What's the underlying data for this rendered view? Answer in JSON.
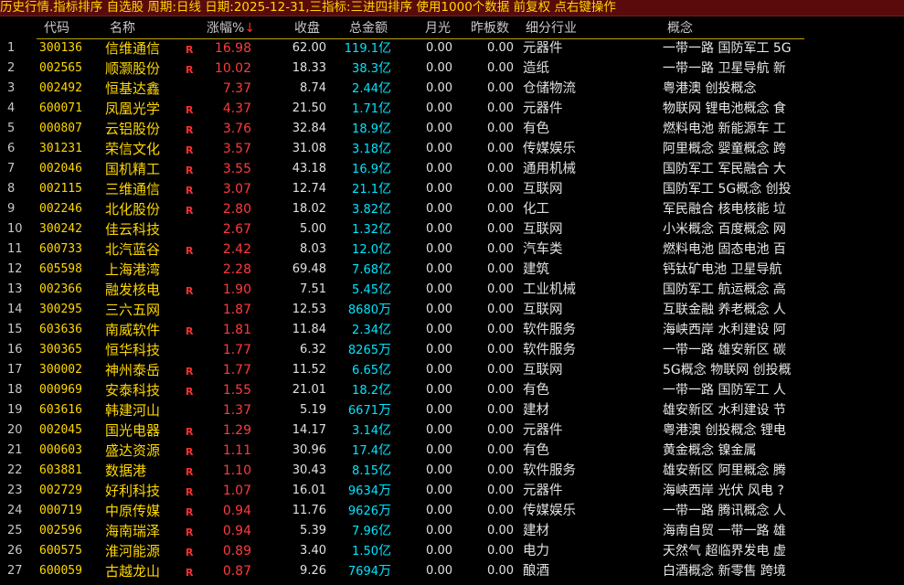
{
  "topbar": {
    "part1": "历史行情.指标排序",
    "part2": "自选股",
    "part3": "周期:",
    "period": "日线",
    "part4": "日期:",
    "date": "2025-12-31,三",
    "part5": "指标:",
    "indicator": "三进四排序",
    "part6": "使用",
    "count": "1000",
    "part7": "个数据 前复权 点右键操作"
  },
  "header": {
    "code": "代码",
    "name": "名称",
    "pct": "涨幅%",
    "sort_arrow": "↓",
    "close": "收盘",
    "amount": "总金额",
    "yueguang": "月光",
    "zhaban": "昨板数",
    "industry": "细分行业",
    "concept": "概念"
  },
  "colors": {
    "topbar_bg": "#5a0a0a",
    "code": "#ffd700",
    "pct": "#ff3b3b",
    "amount": "#00e5ff"
  },
  "rows": [
    {
      "idx": "1",
      "code": "300136",
      "name": "信维通信",
      "r": "R",
      "pct": "16.98",
      "close": "62.00",
      "amt": "119.1",
      "unit": "亿",
      "yg": "0.00",
      "zb": "0.00",
      "ind": "元器件",
      "concept": "一带一路 国防军工 5G"
    },
    {
      "idx": "2",
      "code": "002565",
      "name": "顺灏股份",
      "r": "R",
      "pct": "10.02",
      "close": "18.33",
      "amt": "38.3",
      "unit": "亿",
      "yg": "0.00",
      "zb": "0.00",
      "ind": "造纸",
      "concept": "一带一路 卫星导航 新"
    },
    {
      "idx": "3",
      "code": "002492",
      "name": "恒基达鑫",
      "r": "",
      "pct": "7.37",
      "close": "8.74",
      "amt": "2.44",
      "unit": "亿",
      "yg": "0.00",
      "zb": "0.00",
      "ind": "仓储物流",
      "concept": "粤港澳 创投概念"
    },
    {
      "idx": "4",
      "code": "600071",
      "name": "凤凰光学",
      "r": "R",
      "pct": "4.37",
      "close": "21.50",
      "amt": "1.71",
      "unit": "亿",
      "yg": "0.00",
      "zb": "0.00",
      "ind": "元器件",
      "concept": "物联网 锂电池概念 食"
    },
    {
      "idx": "5",
      "code": "000807",
      "name": "云铝股份",
      "r": "R",
      "pct": "3.76",
      "close": "32.84",
      "amt": "18.9",
      "unit": "亿",
      "yg": "0.00",
      "zb": "0.00",
      "ind": "有色",
      "concept": "燃料电池 新能源车 工"
    },
    {
      "idx": "6",
      "code": "301231",
      "name": "荣信文化",
      "r": "R",
      "pct": "3.57",
      "close": "31.08",
      "amt": "3.18",
      "unit": "亿",
      "yg": "0.00",
      "zb": "0.00",
      "ind": "传媒娱乐",
      "concept": "阿里概念 婴童概念 跨"
    },
    {
      "idx": "7",
      "code": "002046",
      "name": "国机精工",
      "r": "R",
      "pct": "3.55",
      "close": "43.18",
      "amt": "16.9",
      "unit": "亿",
      "yg": "0.00",
      "zb": "0.00",
      "ind": "通用机械",
      "concept": "国防军工 军民融合 大"
    },
    {
      "idx": "8",
      "code": "002115",
      "name": "三维通信",
      "r": "R",
      "pct": "3.07",
      "close": "12.74",
      "amt": "21.1",
      "unit": "亿",
      "yg": "0.00",
      "zb": "0.00",
      "ind": "互联网",
      "concept": "国防军工 5G概念 创投"
    },
    {
      "idx": "9",
      "code": "002246",
      "name": "北化股份",
      "r": "R",
      "pct": "2.80",
      "close": "18.02",
      "amt": "3.82",
      "unit": "亿",
      "yg": "0.00",
      "zb": "0.00",
      "ind": "化工",
      "concept": "军民融合 核电核能 垃"
    },
    {
      "idx": "10",
      "code": "300242",
      "name": "佳云科技",
      "r": "",
      "pct": "2.67",
      "close": "5.00",
      "amt": "1.32",
      "unit": "亿",
      "yg": "0.00",
      "zb": "0.00",
      "ind": "互联网",
      "concept": "小米概念 百度概念 网"
    },
    {
      "idx": "11",
      "code": "600733",
      "name": "北汽蓝谷",
      "r": "R",
      "pct": "2.42",
      "close": "8.03",
      "amt": "12.0",
      "unit": "亿",
      "yg": "0.00",
      "zb": "0.00",
      "ind": "汽车类",
      "concept": "燃料电池 固态电池 百"
    },
    {
      "idx": "12",
      "code": "605598",
      "name": "上海港湾",
      "r": "",
      "pct": "2.28",
      "close": "69.48",
      "amt": "7.68",
      "unit": "亿",
      "yg": "0.00",
      "zb": "0.00",
      "ind": "建筑",
      "concept": "钙钛矿电池 卫星导航"
    },
    {
      "idx": "13",
      "code": "002366",
      "name": "融发核电",
      "r": "R",
      "pct": "1.90",
      "close": "7.51",
      "amt": "5.45",
      "unit": "亿",
      "yg": "0.00",
      "zb": "0.00",
      "ind": "工业机械",
      "concept": "国防军工 航运概念 高"
    },
    {
      "idx": "14",
      "code": "300295",
      "name": "三六五网",
      "r": "",
      "pct": "1.87",
      "close": "12.53",
      "amt": "8680",
      "unit": "万",
      "yg": "0.00",
      "zb": "0.00",
      "ind": "互联网",
      "concept": "互联金融 养老概念 人"
    },
    {
      "idx": "15",
      "code": "603636",
      "name": "南威软件",
      "r": "R",
      "pct": "1.81",
      "close": "11.84",
      "amt": "2.34",
      "unit": "亿",
      "yg": "0.00",
      "zb": "0.00",
      "ind": "软件服务",
      "concept": "海峡西岸 水利建设 阿"
    },
    {
      "idx": "16",
      "code": "300365",
      "name": "恒华科技",
      "r": "",
      "pct": "1.77",
      "close": "6.32",
      "amt": "8265",
      "unit": "万",
      "yg": "0.00",
      "zb": "0.00",
      "ind": "软件服务",
      "concept": "一带一路 雄安新区 碳"
    },
    {
      "idx": "17",
      "code": "300002",
      "name": "神州泰岳",
      "r": "R",
      "pct": "1.77",
      "close": "11.52",
      "amt": "6.65",
      "unit": "亿",
      "yg": "0.00",
      "zb": "0.00",
      "ind": "互联网",
      "concept": "5G概念 物联网 创投概"
    },
    {
      "idx": "18",
      "code": "000969",
      "name": "安泰科技",
      "r": "R",
      "pct": "1.55",
      "close": "21.01",
      "amt": "18.2",
      "unit": "亿",
      "yg": "0.00",
      "zb": "0.00",
      "ind": "有色",
      "concept": "一带一路 国防军工 人"
    },
    {
      "idx": "19",
      "code": "603616",
      "name": "韩建河山",
      "r": "",
      "pct": "1.37",
      "close": "5.19",
      "amt": "6671",
      "unit": "万",
      "yg": "0.00",
      "zb": "0.00",
      "ind": "建材",
      "concept": "雄安新区 水利建设 节"
    },
    {
      "idx": "20",
      "code": "002045",
      "name": "国光电器",
      "r": "R",
      "pct": "1.29",
      "close": "14.17",
      "amt": "3.14",
      "unit": "亿",
      "yg": "0.00",
      "zb": "0.00",
      "ind": "元器件",
      "concept": "粤港澳 创投概念 锂电"
    },
    {
      "idx": "21",
      "code": "000603",
      "name": "盛达资源",
      "r": "R",
      "pct": "1.11",
      "close": "30.96",
      "amt": "17.4",
      "unit": "亿",
      "yg": "0.00",
      "zb": "0.00",
      "ind": "有色",
      "concept": "黄金概念 镍金属"
    },
    {
      "idx": "22",
      "code": "603881",
      "name": "数据港",
      "r": "R",
      "pct": "1.10",
      "close": "30.43",
      "amt": "8.15",
      "unit": "亿",
      "yg": "0.00",
      "zb": "0.00",
      "ind": "软件服务",
      "concept": "雄安新区 阿里概念 腾"
    },
    {
      "idx": "23",
      "code": "002729",
      "name": "好利科技",
      "r": "R",
      "pct": "1.07",
      "close": "16.01",
      "amt": "9634",
      "unit": "万",
      "yg": "0.00",
      "zb": "0.00",
      "ind": "元器件",
      "concept": "海峡西岸 光伏 风电 ?"
    },
    {
      "idx": "24",
      "code": "000719",
      "name": "中原传媒",
      "r": "R",
      "pct": "0.94",
      "close": "11.76",
      "amt": "9626",
      "unit": "万",
      "yg": "0.00",
      "zb": "0.00",
      "ind": "传媒娱乐",
      "concept": "一带一路 腾讯概念 人"
    },
    {
      "idx": "25",
      "code": "002596",
      "name": "海南瑞泽",
      "r": "R",
      "pct": "0.94",
      "close": "5.39",
      "amt": "7.96",
      "unit": "亿",
      "yg": "0.00",
      "zb": "0.00",
      "ind": "建材",
      "concept": "海南自贸 一带一路 雄"
    },
    {
      "idx": "26",
      "code": "600575",
      "name": "淮河能源",
      "r": "R",
      "pct": "0.89",
      "close": "3.40",
      "amt": "1.50",
      "unit": "亿",
      "yg": "0.00",
      "zb": "0.00",
      "ind": "电力",
      "concept": "天然气 超临界发电 虚"
    },
    {
      "idx": "27",
      "code": "600059",
      "name": "古越龙山",
      "r": "R",
      "pct": "0.87",
      "close": "9.26",
      "amt": "7694",
      "unit": "万",
      "yg": "0.00",
      "zb": "0.00",
      "ind": "酿酒",
      "concept": "白酒概念 新零售 跨境"
    }
  ]
}
